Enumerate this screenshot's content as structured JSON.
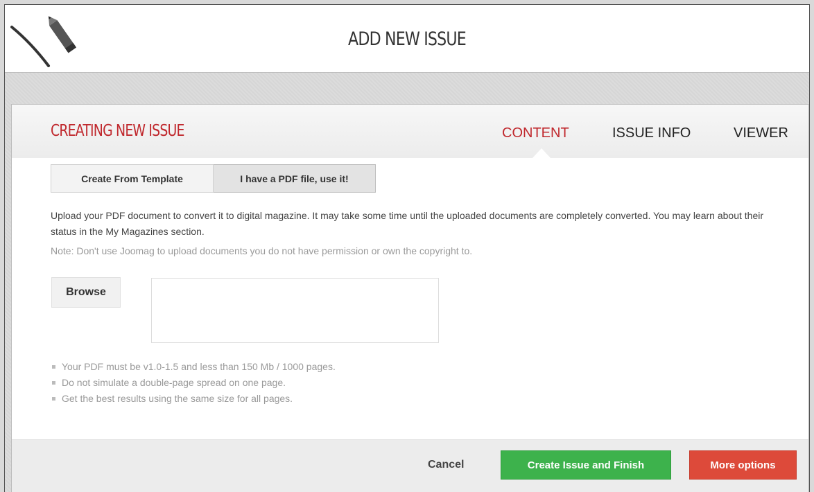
{
  "header": {
    "title": "ADD NEW ISSUE",
    "logo_icon": "pencil-icon"
  },
  "panel": {
    "title": "CREATING NEW ISSUE",
    "tabs": [
      {
        "label": "CONTENT",
        "active": true
      },
      {
        "label": "ISSUE INFO",
        "active": false
      },
      {
        "label": "VIEWER",
        "active": false
      }
    ],
    "source_buttons": {
      "template_label": "Create From Template",
      "pdf_label": "I have a PDF file, use it!",
      "selected": "pdf"
    },
    "description": "Upload your PDF document to convert it to digital magazine. It may take some time until the uploaded documents are completely converted. You may learn about their status in the My Magazines section.",
    "note": "Note: Don't use Joomag to upload documents you do not have permission or own the copyright to.",
    "browse_label": "Browse",
    "rules": [
      "Your PDF must be v1.0-1.5 and less than 150 Mb / 1000 pages.",
      "Do not simulate a double-page spread on one page.",
      "Get the best results using the same size for all pages."
    ]
  },
  "footer": {
    "cancel_label": "Cancel",
    "create_label": "Create Issue and Finish",
    "more_label": "More options"
  },
  "colors": {
    "accent_red": "#c0282d",
    "create_green": "#3db24c",
    "more_red": "#dd4a3a"
  }
}
